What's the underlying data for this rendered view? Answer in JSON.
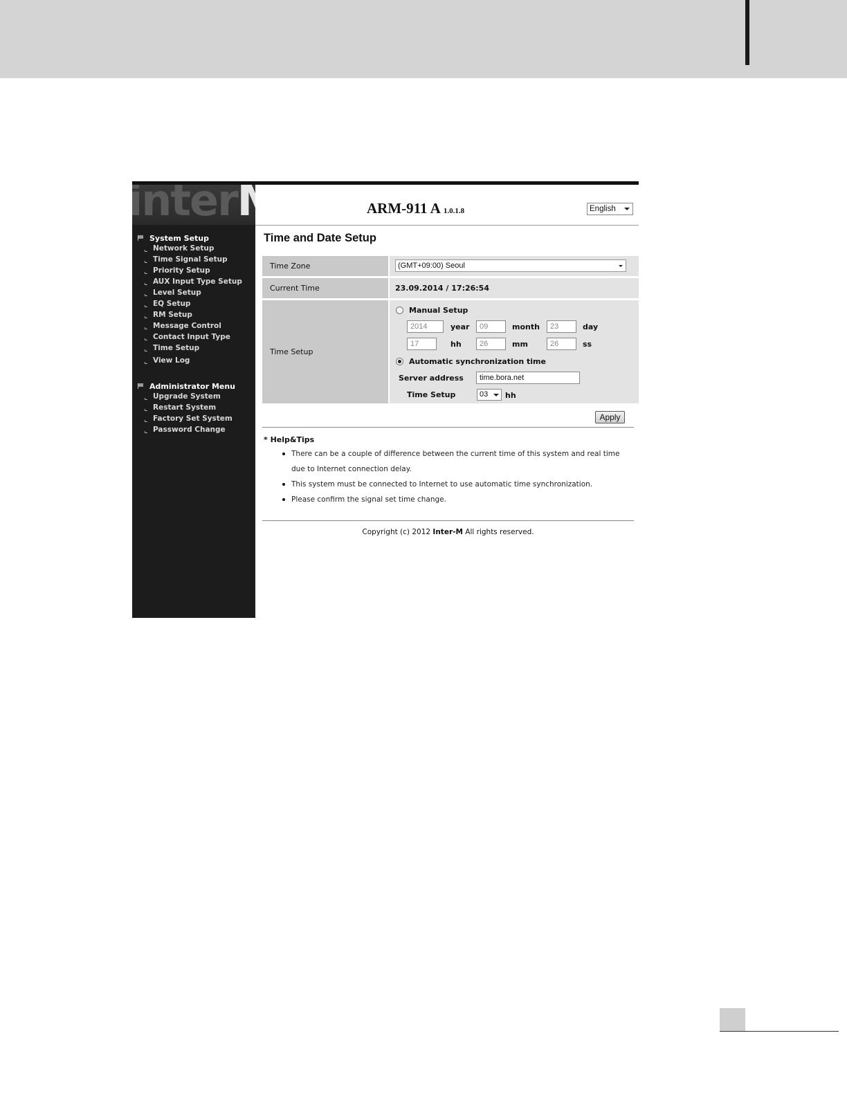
{
  "logo": {
    "main": "inter",
    "accent": "M"
  },
  "sidebar": {
    "system_setup": {
      "title": "System Setup",
      "items": [
        {
          "label": "Network Setup"
        },
        {
          "label": "Time Signal Setup"
        },
        {
          "label": "Priority Setup"
        },
        {
          "label": "AUX Input Type Setup"
        },
        {
          "label": "Level Setup"
        },
        {
          "label": "EQ Setup"
        },
        {
          "label": "RM Setup"
        },
        {
          "label": "Message Control"
        },
        {
          "label": "Contact Input Type"
        },
        {
          "label": "Time Setup"
        },
        {
          "label": "View Log"
        }
      ]
    },
    "admin_menu": {
      "title": "Administrator Menu",
      "items": [
        {
          "label": "Upgrade System"
        },
        {
          "label": "Restart System"
        },
        {
          "label": "Factory Set System"
        },
        {
          "label": "Password Change"
        }
      ]
    }
  },
  "header": {
    "product": "ARM-911 A",
    "version": "1.0.1.8",
    "language": "English"
  },
  "page": {
    "title": "Time and Date Setup"
  },
  "form": {
    "time_zone": {
      "label": "Time Zone",
      "value": "(GMT+09:00) Seoul"
    },
    "current_time": {
      "label": "Current Time",
      "value": "23.09.2014 / 17:26:54"
    },
    "time_setup": {
      "label": "Time Setup",
      "manual": {
        "label": "Manual Setup",
        "selected": false,
        "year": "2014",
        "year_unit": "year",
        "month": "09",
        "month_unit": "month",
        "day": "23",
        "day_unit": "day",
        "hour": "17",
        "hour_unit": "hh",
        "minute": "26",
        "minute_unit": "mm",
        "second": "26",
        "second_unit": "ss"
      },
      "auto": {
        "label": "Automatic synchronization time",
        "selected": true,
        "server_label": "Server address",
        "server_value": "time.bora.net",
        "setup_label": "Time Setup",
        "setup_hour": "03",
        "setup_unit": "hh"
      }
    },
    "apply_label": "Apply"
  },
  "help": {
    "title": "* Help&Tips",
    "tips": [
      "There can be a couple of difference between the current time of this system and real time due to Internet connection delay.",
      "This system must be connected to Internet to use automatic time synchronization.",
      "Please confirm the signal set time change."
    ]
  },
  "footer": {
    "prefix": "Copyright (c) 2012",
    "brand": "Inter-M",
    "suffix": "All rights reserved."
  },
  "colors": {
    "sidebar_bg": "#1c1c1c",
    "label_cell": "#c9c9c9",
    "value_cell": "#e3e3e3",
    "page_header": "#d4d4d4"
  }
}
